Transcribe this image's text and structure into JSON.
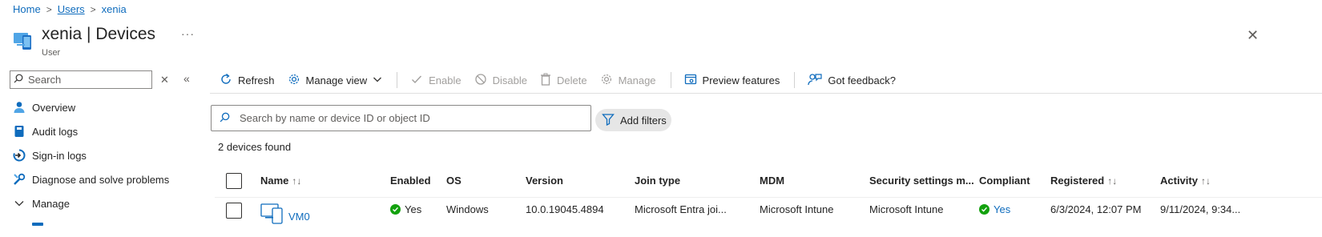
{
  "breadcrumb": {
    "home": "Home",
    "users": "Users",
    "current": "xenia",
    "sep": ">"
  },
  "header": {
    "title": "xenia | Devices",
    "subtitle": "User",
    "more": "···",
    "close": "✕"
  },
  "nav": {
    "search_placeholder": "Search",
    "clear": "✕",
    "collapse": "«",
    "items": [
      {
        "label": "Overview",
        "icon": "user-icon"
      },
      {
        "label": "Audit logs",
        "icon": "book-icon"
      },
      {
        "label": "Sign-in logs",
        "icon": "sign-in-icon"
      },
      {
        "label": "Diagnose and solve problems",
        "icon": "wrench-icon"
      },
      {
        "label": "Manage",
        "icon": "chevron-down-icon"
      }
    ]
  },
  "toolbar": {
    "refresh": "Refresh",
    "manage_view": "Manage view",
    "enable": "Enable",
    "disable": "Disable",
    "delete": "Delete",
    "manage": "Manage",
    "preview_features": "Preview features",
    "feedback": "Got feedback?"
  },
  "search": {
    "placeholder": "Search by name or device ID or object ID"
  },
  "filters": {
    "add_label": "Add filters"
  },
  "result_count": "2 devices found",
  "table": {
    "columns": {
      "name": "Name",
      "enabled": "Enabled",
      "os": "OS",
      "version": "Version",
      "join_type": "Join type",
      "mdm": "MDM",
      "security": "Security settings m...",
      "compliant": "Compliant",
      "registered": "Registered",
      "activity": "Activity"
    },
    "sort_glyph": "↑↓",
    "rows": [
      {
        "name": "VM0",
        "enabled": "Yes",
        "os": "Windows",
        "version": "10.0.19045.4894",
        "join_type": "Microsoft Entra joi...",
        "mdm": "Microsoft Intune",
        "security": "Microsoft Intune",
        "compliant": "Yes",
        "registered": "6/3/2024, 12:07 PM",
        "activity": "9/11/2024, 9:34..."
      }
    ]
  },
  "colors": {
    "accent": "#0f6cbd",
    "success": "#13a10e",
    "disabled": "#a19f9d"
  }
}
